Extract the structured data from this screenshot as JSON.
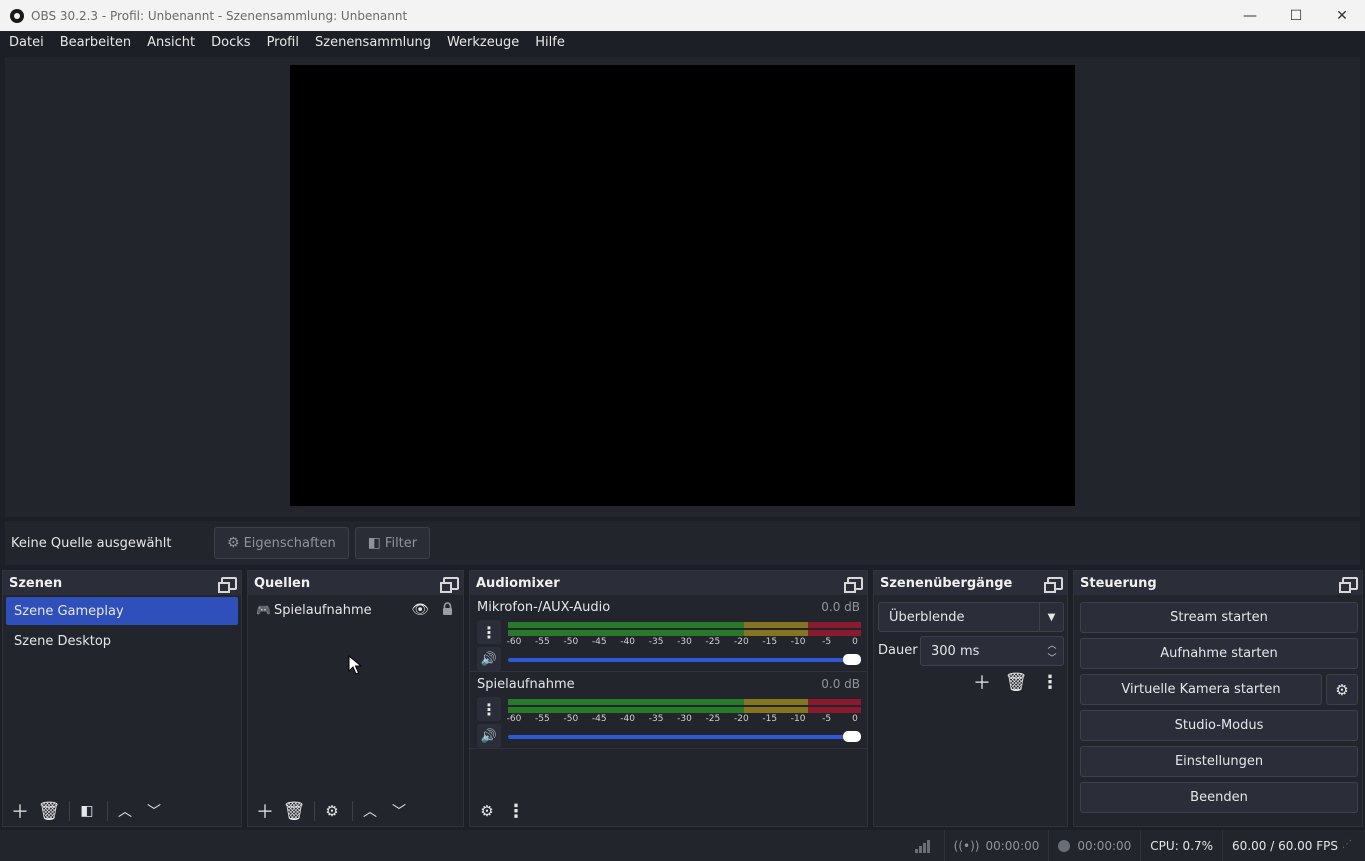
{
  "window": {
    "title": "OBS 30.2.3 - Profil: Unbenannt - Szenensammlung: Unbenannt",
    "minimize": "—",
    "maximize": "☐",
    "close": "✕"
  },
  "menu": [
    "Datei",
    "Bearbeiten",
    "Ansicht",
    "Docks",
    "Profil",
    "Szenensammlung",
    "Werkzeuge",
    "Hilfe"
  ],
  "context": {
    "label": "Keine Quelle ausgewählt",
    "properties": "Eigenschaften",
    "filter": "Filter"
  },
  "scenes": {
    "title": "Szenen",
    "items": [
      "Szene Gameplay",
      "Szene Desktop"
    ],
    "selected_index": 0
  },
  "sources": {
    "title": "Quellen",
    "items": [
      {
        "name": "Spielaufnahme",
        "icon": "gamepad-icon"
      }
    ]
  },
  "audiomixer": {
    "title": "Audiomixer",
    "scale": [
      "-60",
      "-55",
      "-50",
      "-45",
      "-40",
      "-35",
      "-30",
      "-25",
      "-20",
      "-15",
      "-10",
      "-5",
      "0"
    ],
    "channels": [
      {
        "name": "Mikrofon-/AUX-Audio",
        "db": "0.0 dB",
        "volume": 1.0
      },
      {
        "name": "Spielaufnahme",
        "db": "0.0 dB",
        "volume": 1.0
      }
    ]
  },
  "transitions": {
    "title": "Szenenübergänge",
    "selected": "Überblende",
    "duration_label": "Dauer",
    "duration_value": "300 ms"
  },
  "controls": {
    "title": "Steuerung",
    "stream": "Stream starten",
    "record": "Aufnahme starten",
    "virtualcam": "Virtuelle Kamera starten",
    "studio": "Studio-Modus",
    "settings": "Einstellungen",
    "exit": "Beenden"
  },
  "status": {
    "stream_time": "00:00:00",
    "rec_time": "00:00:00",
    "cpu": "CPU: 0.7%",
    "fps": "60.00 / 60.00 FPS"
  },
  "colors": {
    "selected": "#2f4fba",
    "meter_green": "#267a2a",
    "meter_yellow": "#867520",
    "meter_red": "#8a1b2e",
    "slider": "#2f58d6"
  }
}
